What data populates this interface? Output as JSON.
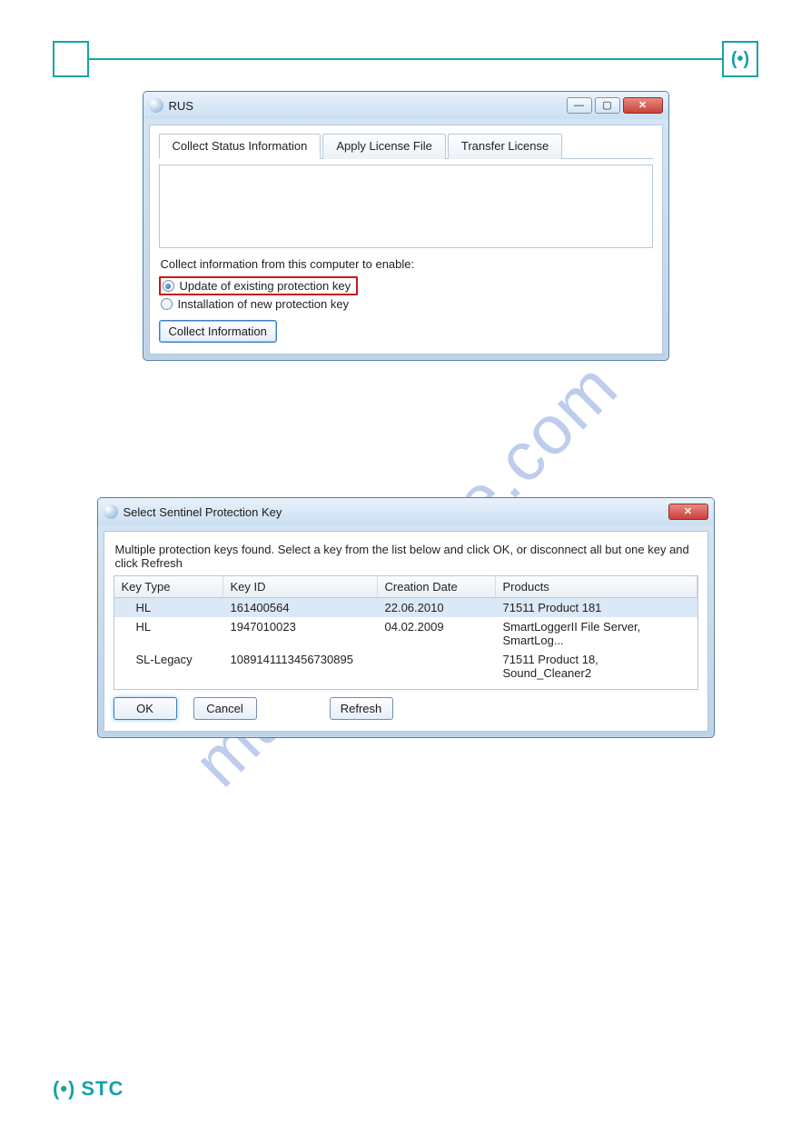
{
  "page_logo_text": "STC",
  "watermark_text": "manualshive.com",
  "rus_window": {
    "title": "RUS",
    "tabs": [
      {
        "label": "Collect Status Information",
        "active": true
      },
      {
        "label": "Apply License File",
        "active": false
      },
      {
        "label": "Transfer License",
        "active": false
      }
    ],
    "instruction": "Collect information from this computer to enable:",
    "option_update": "Update of existing protection key",
    "option_install": "Installation of new protection key",
    "collect_button": "Collect Information"
  },
  "select_window": {
    "title": "Select Sentinel Protection Key",
    "message": "Multiple protection keys found. Select a key from the list below and click OK, or disconnect all but one key and click Refresh",
    "columns": {
      "key_type": "Key Type",
      "key_id": "Key ID",
      "creation_date": "Creation Date",
      "products": "Products"
    },
    "rows": [
      {
        "key_type": "HL",
        "key_id": "161400564",
        "creation_date": "22.06.2010",
        "products": "71511 Product 181",
        "selected": true
      },
      {
        "key_type": "HL",
        "key_id": "1947010023",
        "creation_date": "04.02.2009",
        "products": "SmartLoggerII File Server, SmartLog...",
        "selected": false
      },
      {
        "key_type": "SL-Legacy",
        "key_id": "1089141113456730895",
        "creation_date": "",
        "products": "71511 Product 18, Sound_Cleaner2",
        "selected": false
      }
    ],
    "buttons": {
      "ok": "OK",
      "cancel": "Cancel",
      "refresh": "Refresh"
    }
  }
}
